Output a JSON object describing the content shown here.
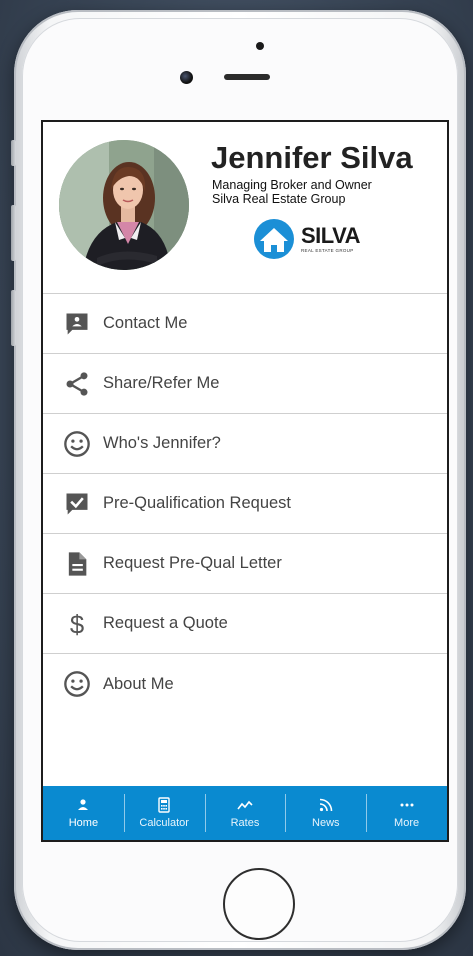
{
  "profile": {
    "name": "Jennifer Silva",
    "title": "Managing Broker and Owner",
    "company": "Silva Real Estate Group",
    "logo_word": "SILVA",
    "logo_sub": "REAL ESTATE GROUP"
  },
  "menu": [
    {
      "label": "Contact Me",
      "icon": "chat-bubble-icon"
    },
    {
      "label": "Share/Refer Me",
      "icon": "share-icon"
    },
    {
      "label": "Who's Jennifer?",
      "icon": "smiley-icon"
    },
    {
      "label": "Pre-Qualification Request",
      "icon": "checkmark-chat-icon"
    },
    {
      "label": "Request Pre-Qual Letter",
      "icon": "document-icon"
    },
    {
      "label": "Request a Quote",
      "icon": "dollar-icon"
    },
    {
      "label": "About Me",
      "icon": "smiley-icon"
    }
  ],
  "tabs": [
    {
      "label": "Home",
      "icon": "person-icon",
      "active": true
    },
    {
      "label": "Calculator",
      "icon": "calculator-icon",
      "active": false
    },
    {
      "label": "Rates",
      "icon": "trend-icon",
      "active": false
    },
    {
      "label": "News",
      "icon": "rss-icon",
      "active": false
    },
    {
      "label": "More",
      "icon": "ellipsis-icon",
      "active": false
    }
  ],
  "colors": {
    "tabbar": "#0a8ad0",
    "logo_blue": "#1b8fd6",
    "icon_gray": "#555555"
  }
}
